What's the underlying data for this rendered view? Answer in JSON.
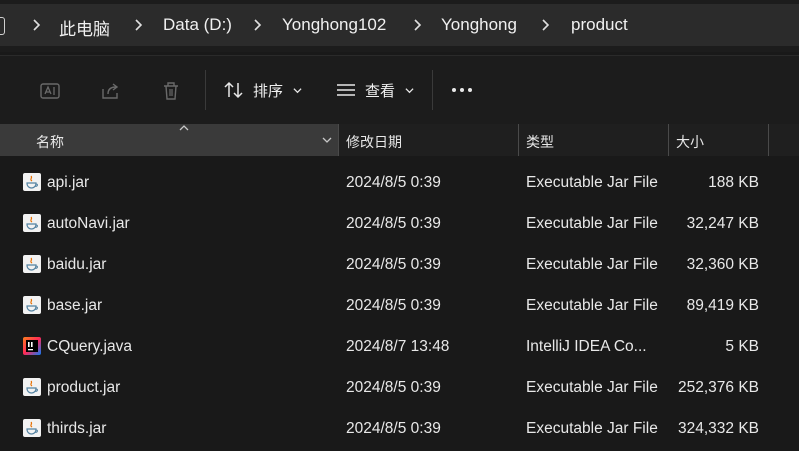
{
  "breadcrumb": [
    "此电脑",
    "Data (D:)",
    "Yonghong102",
    "Yonghong",
    "product"
  ],
  "toolbar": {
    "sort_label": "排序",
    "view_label": "查看"
  },
  "columns": {
    "name": "名称",
    "date": "修改日期",
    "type": "类型",
    "size": "大小"
  },
  "files": [
    {
      "name": "api.jar",
      "date": "2024/8/5 0:39",
      "type": "Executable Jar File",
      "size": "188 KB",
      "icon": "java-jar-icon"
    },
    {
      "name": "autoNavi.jar",
      "date": "2024/8/5 0:39",
      "type": "Executable Jar File",
      "size": "32,247 KB",
      "icon": "java-jar-icon"
    },
    {
      "name": "baidu.jar",
      "date": "2024/8/5 0:39",
      "type": "Executable Jar File",
      "size": "32,360 KB",
      "icon": "java-jar-icon"
    },
    {
      "name": "base.jar",
      "date": "2024/8/5 0:39",
      "type": "Executable Jar File",
      "size": "89,419 KB",
      "icon": "java-jar-icon"
    },
    {
      "name": "CQuery.java",
      "date": "2024/8/7 13:48",
      "type": "IntelliJ IDEA Co...",
      "size": "5 KB",
      "icon": "intellij-java-icon"
    },
    {
      "name": "product.jar",
      "date": "2024/8/5 0:39",
      "type": "Executable Jar File",
      "size": "252,376 KB",
      "icon": "java-jar-icon"
    },
    {
      "name": "thirds.jar",
      "date": "2024/8/5 0:39",
      "type": "Executable Jar File",
      "size": "324,332 KB",
      "icon": "java-jar-icon"
    }
  ]
}
